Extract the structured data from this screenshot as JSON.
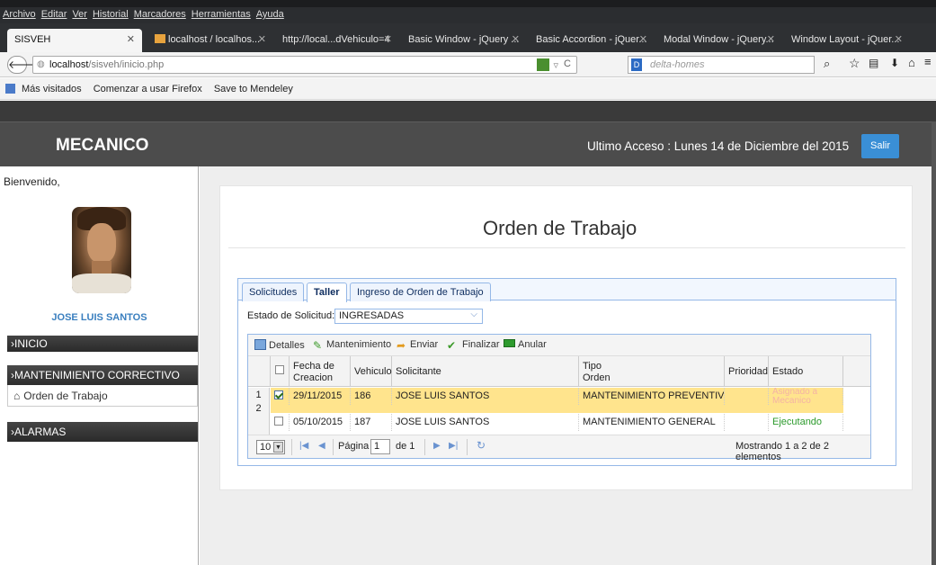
{
  "browser": {
    "menu": [
      "Archivo",
      "Editar",
      "Ver",
      "Historial",
      "Marcadores",
      "Herramientas",
      "Ayuda"
    ],
    "tabs": [
      {
        "label": "SISVEH"
      },
      {
        "label": "localhost / localhos..."
      },
      {
        "label": "http://local...dVehiculo=4"
      },
      {
        "label": "Basic Window - jQuery ..."
      },
      {
        "label": "Basic Accordion - jQuer..."
      },
      {
        "label": "Modal Window - jQuery..."
      },
      {
        "label": "Window Layout - jQuer..."
      }
    ],
    "url_host": "localhost",
    "url_path": "/sisveh/inicio.php",
    "search_placeholder": "delta-homes",
    "bookmarks": [
      "Más visitados",
      "Comenzar a usar Firefox",
      "Save to Mendeley"
    ]
  },
  "header": {
    "brand": "MECANICO",
    "last_access": "Ultimo Acceso : Lunes 14 de Diciembre del 2015",
    "logout": "Salir"
  },
  "sidebar": {
    "welcome": "Bienvenido,",
    "user_name": "JOSE LUIS SANTOS",
    "menu": [
      {
        "label": "›INICIO"
      },
      {
        "label": "›MANTENIMIENTO CORRECTIVO"
      },
      {
        "label": "Orden de Trabajo"
      },
      {
        "label": "›ALARMAS"
      }
    ]
  },
  "main": {
    "title": "Orden de Trabajo",
    "tabs": [
      "Solicitudes",
      "Taller",
      "Ingreso de Orden de Trabajo"
    ],
    "active_tab": "Taller",
    "status_label": "Estado de Solicitud:",
    "status_value": "INGRESADAS",
    "toolbar": [
      "Detalles",
      "Mantenimiento",
      "Enviar",
      "Finalizar",
      "Anular"
    ],
    "columns": [
      "Fecha de Creacion",
      "Vehiculo",
      "Solicitante",
      "Tipo Orden",
      "Prioridad",
      "Estado"
    ],
    "rows": [
      {
        "num": "1",
        "checked": true,
        "fecha": "29/11/2015",
        "vehiculo": "186",
        "solicitante": "JOSE LUIS SANTOS",
        "tipo": "MANTENIMIENTO PREVENTIVO",
        "prioridad": "",
        "estado": "Asignado a Mecanico"
      },
      {
        "num": "2",
        "checked": false,
        "fecha": "05/10/2015",
        "vehiculo": "187",
        "solicitante": "JOSE LUIS SANTOS",
        "tipo": "MANTENIMIENTO GENERAL",
        "prioridad": "",
        "estado": "Ejecutando"
      }
    ],
    "pager": {
      "page_size": "10",
      "page_label": "Página",
      "page": "1",
      "of": "de 1",
      "summary": "Mostrando 1 a 2 de 2 elementos"
    }
  },
  "colors": {
    "accent": "#3a8fd6",
    "header_bg": "#4c4c4c",
    "selected_row": "#ffe48d",
    "estado_asignado": "#f4b3a5",
    "estado_ejecutando": "#2b9a2b",
    "panel_border": "#95b8e7"
  }
}
